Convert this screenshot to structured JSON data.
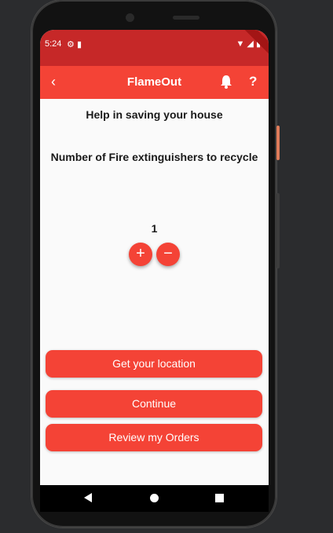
{
  "status_bar": {
    "time": "5:24",
    "left_icons": [
      "gear-icon",
      "sd-card-icon"
    ],
    "right_icons": [
      "wifi-icon",
      "signal-icon",
      "battery-icon"
    ]
  },
  "app_bar": {
    "title": "FlameOut",
    "back_icon": "chevron-left-icon",
    "help_label": "?"
  },
  "content": {
    "heading": "Help in saving your house",
    "subheading": "Number of Fire extinguishers to recycle",
    "count": "1",
    "increment_label": "+",
    "decrement_label": "−"
  },
  "buttons": {
    "location": "Get your location",
    "continue": "Continue",
    "orders": "Review my Orders"
  },
  "colors": {
    "primary": "#f44336",
    "status_bar": "#c62828",
    "background": "#fafafa"
  }
}
